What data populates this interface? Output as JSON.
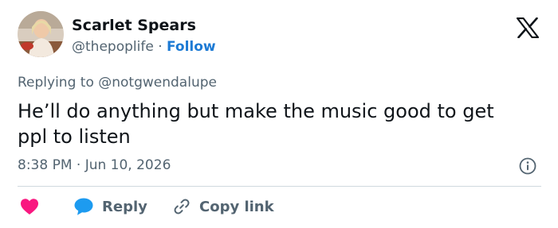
{
  "author": {
    "display_name": "Scarlet Spears",
    "handle": "@thepoplife",
    "separator": "·",
    "follow_label": "Follow"
  },
  "reply_context": "Replying to @notgwendalupe",
  "tweet": {
    "text_lines": [
      "He’ll do anything but make the music good to get",
      "ppl to listen"
    ]
  },
  "timestamp": "8:38 PM · Jun 10, 2026",
  "actions": {
    "reply_label": "Reply",
    "copy_link_label": "Copy link"
  },
  "icons": {
    "logo": "x-logo-icon",
    "info": "info-icon",
    "like": "heart-icon",
    "reply": "speech-bubble-icon",
    "copy": "link-icon"
  },
  "colors": {
    "text": "#0f1419",
    "secondary": "#536471",
    "link": "#1d7ad4",
    "like": "#f91880",
    "reply_bubble": "#1d9bf0",
    "divider": "#cfd9de"
  }
}
